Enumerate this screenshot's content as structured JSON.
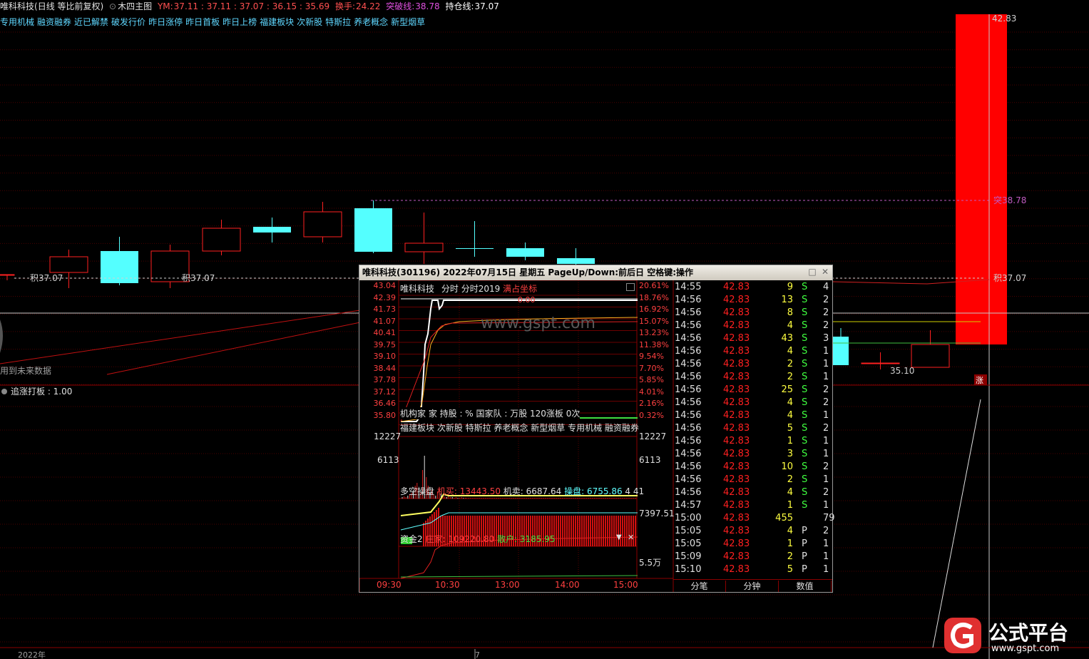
{
  "header": {
    "stock_name": "唯科科技",
    "period": "(日线 等比前复权)",
    "indicator": "木四主图",
    "ym_label": "YM:",
    "ym_values": "37.11 : 37.11 : 37.07 : 36.15 : 35.69",
    "turnover_label": "换手:",
    "turnover_value": "24.22",
    "breakout_label": "突破线:",
    "breakout_value": "38.78",
    "hold_label": "持仓线:",
    "hold_value": "37.07"
  },
  "concept_tags": [
    "专用机械",
    "融资融券",
    "近已解禁",
    "破发行价",
    "昨日涨停",
    "昨日首板",
    "昨日上榜",
    "福建板块",
    "次新股",
    "特斯拉",
    "养老概念",
    "新型烟草"
  ],
  "main_chart": {
    "price_top_label": "42.83",
    "breakout_label": "突38.78",
    "hold_label_right": "积37.07",
    "hold_label_left1": "积37.07",
    "hold_label_left2": "积37.07",
    "low_label": "35.10",
    "future_data_text": "用到未来数据",
    "sub_indicator": "追涨打板 : 1.00",
    "zhang_badge": "涨",
    "year_label": "2022年",
    "month_label": "7",
    "colors": {
      "up": "#ff2020",
      "down": "#54ffff",
      "grid": "#5a0000"
    }
  },
  "popup": {
    "title": "唯科科技(301196)  2022年07月15日  星期五  PageUp/Down:前后日  空格键:操作",
    "intraday": {
      "name": "唯科科技",
      "mode1": "分时",
      "mode2": "分时2019",
      "mode3": "满占坐标",
      "price_labels": [
        "43.04",
        "42.39",
        "41.73",
        "41.07",
        "40.41",
        "39.75",
        "39.10",
        "38.44",
        "37.78",
        "37.12",
        "36.46",
        "35.80"
      ],
      "pct_labels": [
        "20.61%",
        "18.76%",
        "16.92%",
        "15.07%",
        "13.23%",
        "11.38%",
        "9.54%",
        "7.70%",
        "5.85%",
        "4.01%",
        "2.16%",
        "0.32%"
      ],
      "zero_label": "0.00",
      "inst_line": "机构家 家 持股 : % 国家队 : 万股 120涨板 0次",
      "concept_line": "福建板块 次新股 特斯拉 养老概念 新型烟草 专用机械 融资融券",
      "vol_labels": [
        "12227",
        "6113"
      ],
      "duokong_title": "多空操盘",
      "duokong_buy": "机买: 13443.50",
      "duokong_sell": "机卖: 6687.64",
      "duokong_op": "操盘: 6755.86",
      "duokong_extra": "4 41",
      "duokong_right": "7397.51",
      "zijin_title": "资金2",
      "zijin_dealer": "庄家: 109220.80",
      "zijin_retail": "散户: 3185.95",
      "zijin_right": "5.5万",
      "times": [
        "09:30",
        "10:30",
        "13:00",
        "14:00",
        "15:00"
      ],
      "watermark": "www.gspt.com"
    },
    "ticks": [
      {
        "time": "14:55",
        "price": "42.83",
        "vol": "9",
        "dir": "S",
        "cnt": "4"
      },
      {
        "time": "14:56",
        "price": "42.83",
        "vol": "13",
        "dir": "S",
        "cnt": "2"
      },
      {
        "time": "14:56",
        "price": "42.83",
        "vol": "8",
        "dir": "S",
        "cnt": "2"
      },
      {
        "time": "14:56",
        "price": "42.83",
        "vol": "4",
        "dir": "S",
        "cnt": "2"
      },
      {
        "time": "14:56",
        "price": "42.83",
        "vol": "43",
        "dir": "S",
        "cnt": "3"
      },
      {
        "time": "14:56",
        "price": "42.83",
        "vol": "4",
        "dir": "S",
        "cnt": "1"
      },
      {
        "time": "14:56",
        "price": "42.83",
        "vol": "2",
        "dir": "S",
        "cnt": "1"
      },
      {
        "time": "14:56",
        "price": "42.83",
        "vol": "2",
        "dir": "S",
        "cnt": "1"
      },
      {
        "time": "14:56",
        "price": "42.83",
        "vol": "25",
        "dir": "S",
        "cnt": "2"
      },
      {
        "time": "14:56",
        "price": "42.83",
        "vol": "4",
        "dir": "S",
        "cnt": "2"
      },
      {
        "time": "14:56",
        "price": "42.83",
        "vol": "4",
        "dir": "S",
        "cnt": "1"
      },
      {
        "time": "14:56",
        "price": "42.83",
        "vol": "5",
        "dir": "S",
        "cnt": "2"
      },
      {
        "time": "14:56",
        "price": "42.83",
        "vol": "1",
        "dir": "S",
        "cnt": "1"
      },
      {
        "time": "14:56",
        "price": "42.83",
        "vol": "3",
        "dir": "S",
        "cnt": "1"
      },
      {
        "time": "14:56",
        "price": "42.83",
        "vol": "10",
        "dir": "S",
        "cnt": "2"
      },
      {
        "time": "14:56",
        "price": "42.83",
        "vol": "2",
        "dir": "S",
        "cnt": "1"
      },
      {
        "time": "14:56",
        "price": "42.83",
        "vol": "4",
        "dir": "S",
        "cnt": "2"
      },
      {
        "time": "14:57",
        "price": "42.83",
        "vol": "1",
        "dir": "S",
        "cnt": "1"
      },
      {
        "time": "15:00",
        "price": "42.83",
        "vol": "455",
        "dir": "",
        "cnt": "79"
      },
      {
        "time": "15:05",
        "price": "42.83",
        "vol": "4",
        "dir": "P",
        "cnt": "2"
      },
      {
        "time": "15:05",
        "price": "42.83",
        "vol": "1",
        "dir": "P",
        "cnt": "1"
      },
      {
        "time": "15:09",
        "price": "42.83",
        "vol": "2",
        "dir": "P",
        "cnt": "1"
      },
      {
        "time": "15:10",
        "price": "42.83",
        "vol": "5",
        "dir": "P",
        "cnt": "1"
      }
    ],
    "tabs": [
      "分笔",
      "分钟",
      "数值"
    ]
  },
  "logo": {
    "text": "公式平台",
    "url_text": "www.gspt.com"
  }
}
